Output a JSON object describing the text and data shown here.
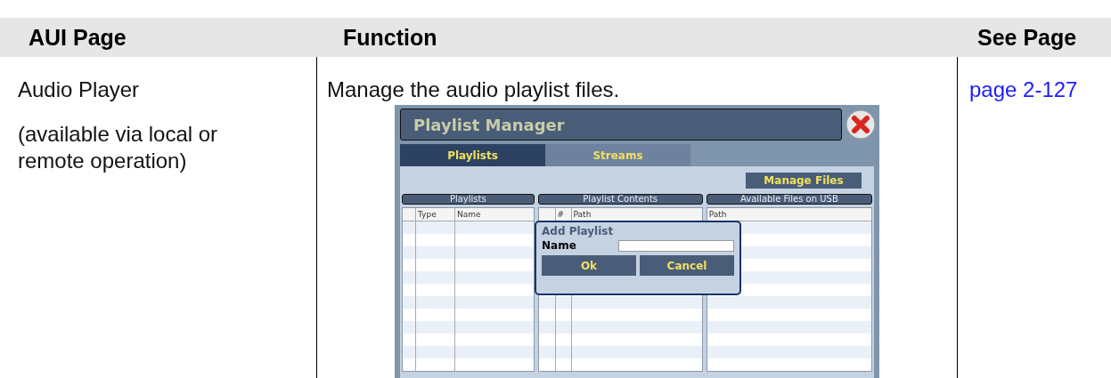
{
  "table": {
    "columns": [
      "AUI Page",
      "Function",
      "See Page"
    ],
    "rows": [
      {
        "page_name": "Audio Player",
        "note": "(available via local or remote operation)",
        "function": "Manage the audio playlist files.",
        "see_page": "page 2-127",
        "screenshot": {
          "title": "Playlist Manager",
          "tabs": [
            {
              "label": "Playlists",
              "selected": true
            },
            {
              "label": "Streams",
              "selected": false
            }
          ],
          "manage_button": "Manage Files",
          "panels": [
            {
              "title": "Playlists",
              "columns": [
                "",
                "Type",
                "Name"
              ]
            },
            {
              "title": "Playlist Contents",
              "columns": [
                "",
                "#",
                "Path"
              ]
            },
            {
              "title": "Available Files on USB",
              "columns": [
                "Path"
              ]
            }
          ],
          "dialog": {
            "title": "Add Playlist",
            "field_label": "Name",
            "buttons": [
              "Ok",
              "Cancel"
            ]
          }
        }
      }
    ]
  }
}
